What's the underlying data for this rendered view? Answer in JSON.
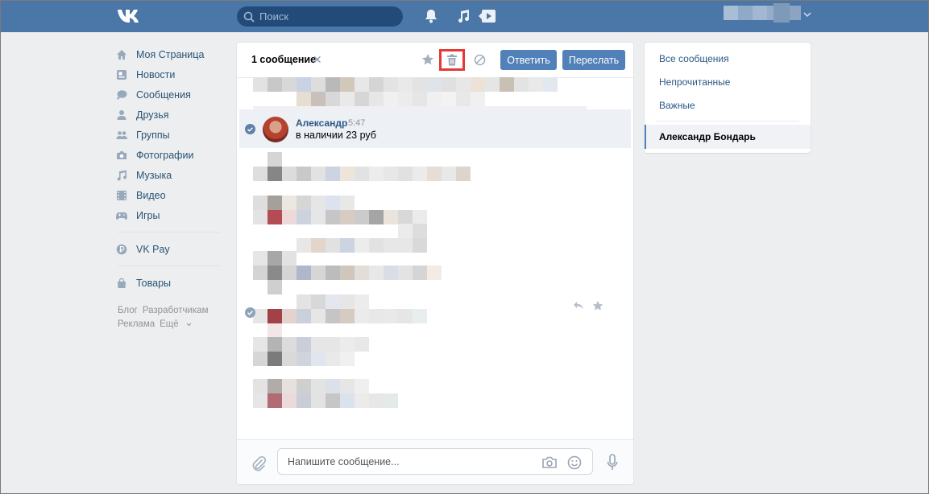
{
  "header": {
    "logo_text": "VK",
    "search_placeholder": "Поиск",
    "icons": [
      "bell-icon",
      "music-icon",
      "play-icon",
      "chevron-down-icon"
    ]
  },
  "sidebar": {
    "items": [
      {
        "label": "Моя Страница",
        "icon": "home-icon"
      },
      {
        "label": "Новости",
        "icon": "news-icon"
      },
      {
        "label": "Сообщения",
        "icon": "messages-icon"
      },
      {
        "label": "Друзья",
        "icon": "friends-icon"
      },
      {
        "label": "Группы",
        "icon": "groups-icon"
      },
      {
        "label": "Фотографии",
        "icon": "camera-icon"
      },
      {
        "label": "Музыка",
        "icon": "music-icon"
      },
      {
        "label": "Видео",
        "icon": "video-icon"
      },
      {
        "label": "Игры",
        "icon": "games-icon"
      },
      {
        "label": "VK Pay",
        "icon": "vkpay-icon"
      },
      {
        "label": "Товары",
        "icon": "bag-icon"
      }
    ],
    "footer": {
      "blog": "Блог",
      "developers": "Разработчикам",
      "ads": "Реклама",
      "more": "Ещё"
    }
  },
  "conversation": {
    "selected_count": "1 сообщение",
    "reply_label": "Ответить",
    "forward_label": "Переслать",
    "message": {
      "author": "Александр",
      "time": "5:47",
      "text": "в наличии 23 руб"
    },
    "composer_placeholder": "Напишите сообщение..."
  },
  "filters": {
    "all": "Все сообщения",
    "unread": "Непрочитанные",
    "important": "Важные",
    "active_chat": "Александр Бондарь"
  },
  "colors": {
    "accent": "#4a76a8",
    "button": "#5181b8",
    "highlight": "#e53935",
    "link": "#2a5885"
  }
}
